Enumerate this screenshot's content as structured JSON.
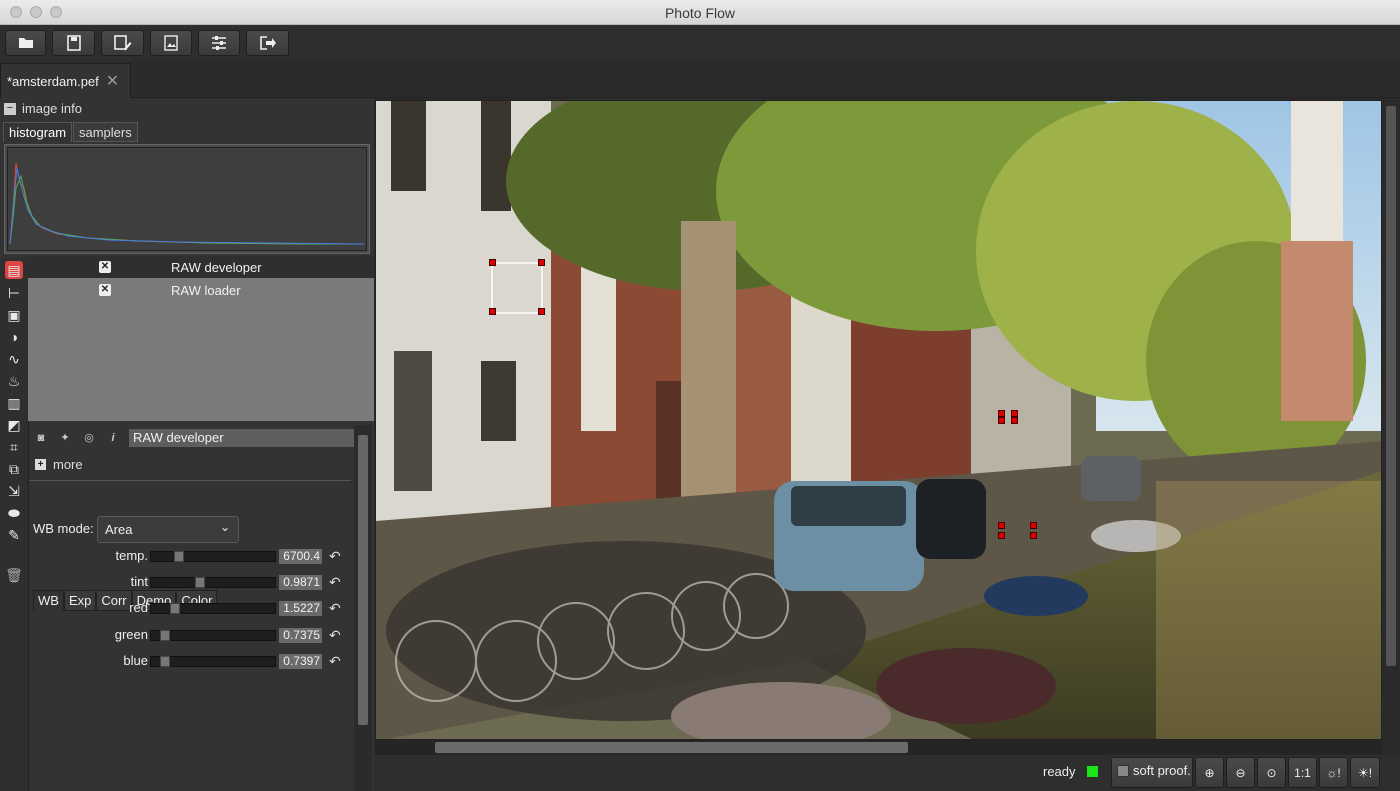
{
  "window": {
    "title": "Photo Flow"
  },
  "file_tab": {
    "name": "*amsterdam.pef",
    "close": "✕"
  },
  "image_info": {
    "label": "image info",
    "tabs": [
      "histogram",
      "samplers"
    ]
  },
  "layers": [
    {
      "name": "RAW developer",
      "selected": true
    },
    {
      "name": "RAW loader",
      "selected": false
    }
  ],
  "developer": {
    "name": "RAW developer",
    "more_label": "more",
    "tabs": [
      "WB",
      "Exp",
      "Corr",
      "Demo",
      "Color"
    ],
    "active_tab": "WB",
    "wb_mode_label": "WB mode:",
    "wb_mode_value": "Area",
    "sliders": [
      {
        "label": "temp.",
        "value": "6700.4",
        "level": 0.2
      },
      {
        "label": "tint",
        "value": "0.9871",
        "level": 0.38
      },
      {
        "label": "red",
        "value": "1.5227",
        "level": 0.16
      },
      {
        "label": "green",
        "value": "0.7375",
        "level": 0.08
      },
      {
        "label": "blue",
        "value": "0.7397",
        "level": 0.08
      }
    ]
  },
  "status": {
    "text": "ready",
    "led_color": "#19e619",
    "soft_proof_label": "soft proof.",
    "one_to_one_label": "1:1"
  },
  "icons": {
    "toolbar": [
      "open-folder-icon",
      "save-icon",
      "save-as-icon",
      "export-image-icon",
      "settings-sliders-icon",
      "exit-icon"
    ],
    "tools": [
      "layers-icon",
      "tree-icon",
      "image-icon",
      "contrast-icon",
      "curves-icon",
      "paint-bucket-icon",
      "gradient-icon",
      "gradient-tool-icon",
      "crop-icon",
      "perspective-icon",
      "clone-icon",
      "ellipse-icon",
      "pencil-icon",
      "trash-icon"
    ]
  },
  "scroll": {
    "horizontal_position": 0.06,
    "horizontal_fraction": 0.47
  }
}
